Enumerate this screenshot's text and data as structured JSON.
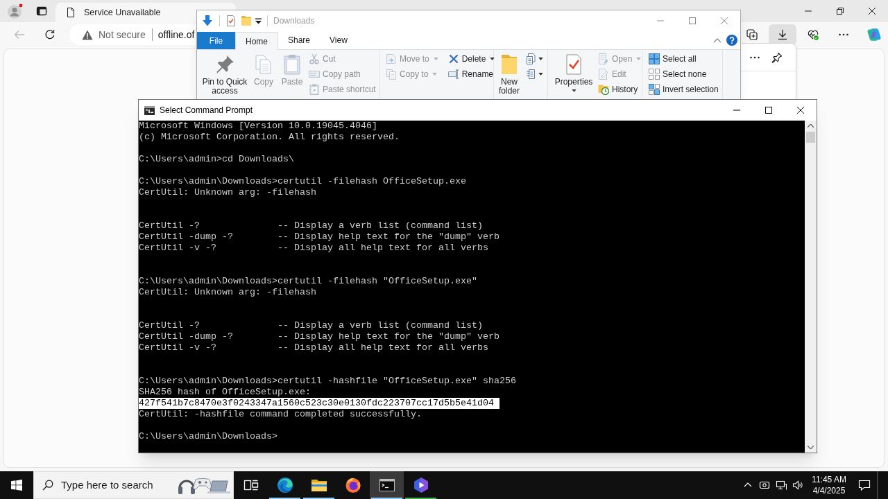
{
  "browser": {
    "tab": {
      "title": "Service Unavailable"
    },
    "address_bar": {
      "security": "Not secure",
      "url": "offline.of"
    },
    "toolbar_buttons": [
      {
        "kind": "collections",
        "selected": false
      },
      {
        "kind": "downloads",
        "selected": true
      },
      {
        "kind": "health",
        "selected": false
      },
      {
        "kind": "more",
        "selected": false
      },
      {
        "kind": "assistant",
        "selected": false
      }
    ]
  },
  "explorer": {
    "title": "Downloads",
    "file_menu": {
      "label": "File"
    },
    "tabs": [
      {
        "label": "Home",
        "selected": true
      },
      {
        "label": "Share",
        "selected": false
      },
      {
        "label": "View",
        "selected": false
      }
    ],
    "ribbon": [
      {
        "columns": [
          [
            {
              "kind": "large",
              "label": "Pin to Quick access",
              "disabled": false,
              "dropdown": false
            }
          ],
          [
            {
              "kind": "large",
              "label": "Copy",
              "disabled": true,
              "dropdown": false
            }
          ],
          [
            {
              "kind": "large",
              "label": "Paste",
              "disabled": true,
              "dropdown": false
            }
          ],
          [
            {
              "kind": "small",
              "label": "Cut",
              "disabled": true,
              "dropdown": false
            },
            {
              "kind": "small",
              "label": "Copy path",
              "disabled": true,
              "dropdown": false
            },
            {
              "kind": "small",
              "label": "Paste shortcut",
              "disabled": true,
              "dropdown": false
            }
          ]
        ]
      },
      {
        "columns": [
          [
            {
              "kind": "small",
              "label": "Move to",
              "disabled": true,
              "dropdown": true
            },
            {
              "kind": "small",
              "label": "Copy to",
              "disabled": true,
              "dropdown": true
            }
          ],
          [
            {
              "kind": "small",
              "label": "Delete",
              "disabled": false,
              "dropdown": true
            },
            {
              "kind": "small",
              "label": "Rename",
              "disabled": false,
              "dropdown": false
            }
          ]
        ]
      },
      {
        "columns": [
          [
            {
              "kind": "large",
              "label": "New folder",
              "disabled": false,
              "dropdown": false
            }
          ],
          [
            {
              "kind": "icon",
              "disabled": false,
              "dropdown": true
            },
            {
              "kind": "icon",
              "disabled": false,
              "dropdown": true
            }
          ]
        ]
      },
      {
        "columns": [
          [
            {
              "kind": "large",
              "label": "Properties",
              "disabled": false,
              "dropdown": true
            }
          ],
          [
            {
              "kind": "small",
              "label": "Open",
              "disabled": true,
              "dropdown": true
            },
            {
              "kind": "small",
              "label": "Edit",
              "disabled": true,
              "dropdown": false
            },
            {
              "kind": "small",
              "label": "History",
              "disabled": false,
              "dropdown": false
            }
          ]
        ]
      },
      {
        "columns": [
          [
            {
              "kind": "small",
              "label": "Select all",
              "disabled": false,
              "dropdown": false
            },
            {
              "kind": "small",
              "label": "Select none",
              "disabled": false,
              "dropdown": false
            },
            {
              "kind": "small",
              "label": "Invert selection",
              "disabled": false,
              "dropdown": false
            }
          ]
        ]
      }
    ]
  },
  "console": {
    "title": "Select Command Prompt",
    "lines": [
      {
        "kind": "text",
        "text": "Microsoft Windows [Version 10.0.19045.4046]",
        "selected": false
      },
      {
        "kind": "text",
        "text": "(c) Microsoft Corporation. All rights reserved.",
        "selected": false
      },
      {
        "kind": "blank"
      },
      {
        "kind": "text",
        "text": "C:\\Users\\admin>cd Downloads\\",
        "selected": false
      },
      {
        "kind": "blank"
      },
      {
        "kind": "text",
        "text": "C:\\Users\\admin\\Downloads>certutil -filehash OfficeSetup.exe",
        "selected": false
      },
      {
        "kind": "text",
        "text": "CertUtil: Unknown arg: -filehash",
        "selected": false
      },
      {
        "kind": "blank"
      },
      {
        "kind": "blank"
      },
      {
        "kind": "text",
        "text": "CertUtil -?              -- Display a verb list (command list)",
        "selected": false
      },
      {
        "kind": "text",
        "text": "CertUtil -dump -?        -- Display help text for the \"dump\" verb",
        "selected": false
      },
      {
        "kind": "text",
        "text": "CertUtil -v -?           -- Display all help text for all verbs",
        "selected": false
      },
      {
        "kind": "blank"
      },
      {
        "kind": "blank"
      },
      {
        "kind": "text",
        "text": "C:\\Users\\admin\\Downloads>certutil -filehash \"OfficeSetup.exe\"",
        "selected": false
      },
      {
        "kind": "text",
        "text": "CertUtil: Unknown arg: -filehash",
        "selected": false
      },
      {
        "kind": "blank"
      },
      {
        "kind": "blank"
      },
      {
        "kind": "text",
        "text": "CertUtil -?              -- Display a verb list (command list)",
        "selected": false
      },
      {
        "kind": "text",
        "text": "CertUtil -dump -?        -- Display help text for the \"dump\" verb",
        "selected": false
      },
      {
        "kind": "text",
        "text": "CertUtil -v -?           -- Display all help text for all verbs",
        "selected": false
      },
      {
        "kind": "blank"
      },
      {
        "kind": "blank"
      },
      {
        "kind": "text",
        "text": "C:\\Users\\admin\\Downloads>certutil -hashfile \"OfficeSetup.exe\" sha256",
        "selected": false
      },
      {
        "kind": "text",
        "text": "SHA256 hash of OfficeSetup.exe:",
        "selected": false
      },
      {
        "kind": "text",
        "text": "427f541b7c8470e3f0243347a1560c523c30e0130fdc223707cc17d5b5e41d04",
        "selected": true
      },
      {
        "kind": "text",
        "text": "CertUtil: -hashfile command completed successfully.",
        "selected": false
      },
      {
        "kind": "blank"
      },
      {
        "kind": "text",
        "text": "C:\\Users\\admin\\Downloads>",
        "selected": false
      }
    ]
  },
  "taskbar": {
    "search": {
      "placeholder": "Type here to search"
    },
    "apps": [
      {
        "kind": "taskview",
        "running": false,
        "selected": false
      },
      {
        "kind": "swirl",
        "running": true,
        "selected": false,
        "color": "#8cc8f5"
      },
      {
        "kind": "folder",
        "running": true,
        "selected": false,
        "color": "#8cc8f5"
      },
      {
        "kind": "ring",
        "running": false,
        "selected": false
      },
      {
        "kind": "terminal",
        "running": true,
        "selected": true,
        "color": "#8cc8f5"
      },
      {
        "kind": "hexagon",
        "running": true,
        "selected": false,
        "color": "#3cb043"
      }
    ],
    "clock": {
      "time": "11:45 AM",
      "date": "4/4/2025"
    }
  }
}
